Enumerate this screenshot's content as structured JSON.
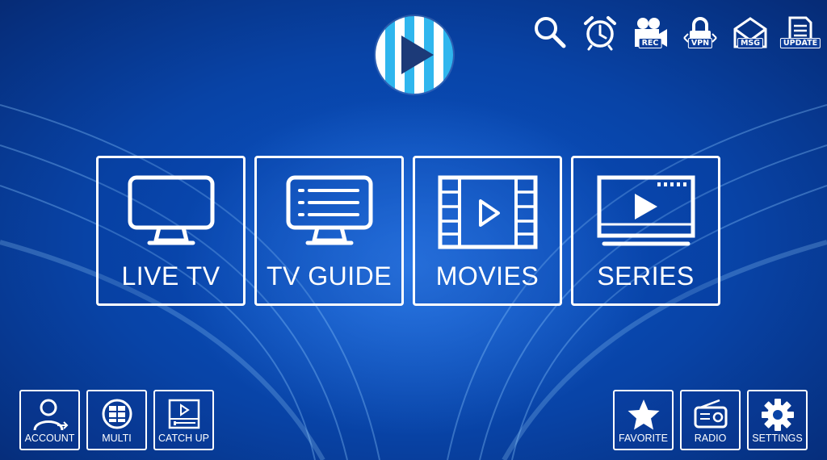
{
  "header": {
    "top_icons": [
      {
        "name": "search-icon",
        "tag": ""
      },
      {
        "name": "alarm-icon",
        "tag": ""
      },
      {
        "name": "record-icon",
        "tag": "REC"
      },
      {
        "name": "vpn-icon",
        "tag": "VPN"
      },
      {
        "name": "message-icon",
        "tag": "MSG"
      },
      {
        "name": "update-icon",
        "tag": "UPDATE"
      }
    ]
  },
  "tiles": [
    {
      "label": "LIVE TV",
      "icon": "tv-icon"
    },
    {
      "label": "TV GUIDE",
      "icon": "tv-guide-icon"
    },
    {
      "label": "MOVIES",
      "icon": "film-icon"
    },
    {
      "label": "SERIES",
      "icon": "series-icon"
    }
  ],
  "bottom_left": [
    {
      "label": "ACCOUNT",
      "icon": "account-icon"
    },
    {
      "label": "MULTI",
      "icon": "multi-screen-icon"
    },
    {
      "label": "CATCH UP",
      "icon": "catch-up-icon"
    }
  ],
  "bottom_right": [
    {
      "label": "FAVORITE",
      "icon": "star-icon"
    },
    {
      "label": "RADIO",
      "icon": "radio-icon"
    },
    {
      "label": "SETTINGS",
      "icon": "gear-icon"
    }
  ],
  "colors": {
    "background": "#0843a6",
    "accent_light_blue": "#2fb6ee",
    "foreground": "#ffffff"
  }
}
